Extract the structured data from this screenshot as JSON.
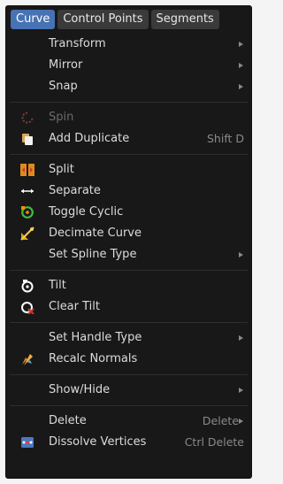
{
  "menu": {
    "tabs": [
      "Curve",
      "Control Points",
      "Segments"
    ],
    "transform": "Transform",
    "mirror": "Mirror",
    "snap": "Snap",
    "spin": "Spin",
    "add_duplicate": "Add Duplicate",
    "add_duplicate_shortcut": "Shift D",
    "split": "Split",
    "separate": "Separate",
    "toggle_cyclic": "Toggle Cyclic",
    "decimate_curve": "Decimate Curve",
    "set_spline_type": "Set Spline Type",
    "tilt": "Tilt",
    "clear_tilt": "Clear Tilt",
    "set_handle_type": "Set Handle Type",
    "recalc_normals": "Recalc Normals",
    "show_hide": "Show/Hide",
    "delete": "Delete",
    "delete_shortcut": "Delete",
    "dissolve_vertices": "Dissolve Vertices",
    "dissolve_vertices_shortcut": "Ctrl Delete"
  },
  "icons": {
    "spin": "spin-icon",
    "add_duplicate": "duplicate-icon",
    "split": "split-icon",
    "separate": "separate-arrows-icon",
    "toggle_cyclic": "cyclic-icon",
    "decimate_curve": "decimate-icon",
    "tilt": "tilt-icon",
    "clear_tilt": "clear-tilt-icon",
    "recalc_normals": "recalc-normals-icon",
    "dissolve_vertices": "dissolve-vertices-icon"
  },
  "colors": {
    "menu_bg": "#181818",
    "accent": "#4772b3",
    "text": "#dcdcdc",
    "disabled_text": "#6b6b6b",
    "shortcut_text": "#8a8a8a",
    "icon_orange": "#e08a1e",
    "icon_green": "#3bbf3b",
    "icon_red": "#c8382e"
  }
}
